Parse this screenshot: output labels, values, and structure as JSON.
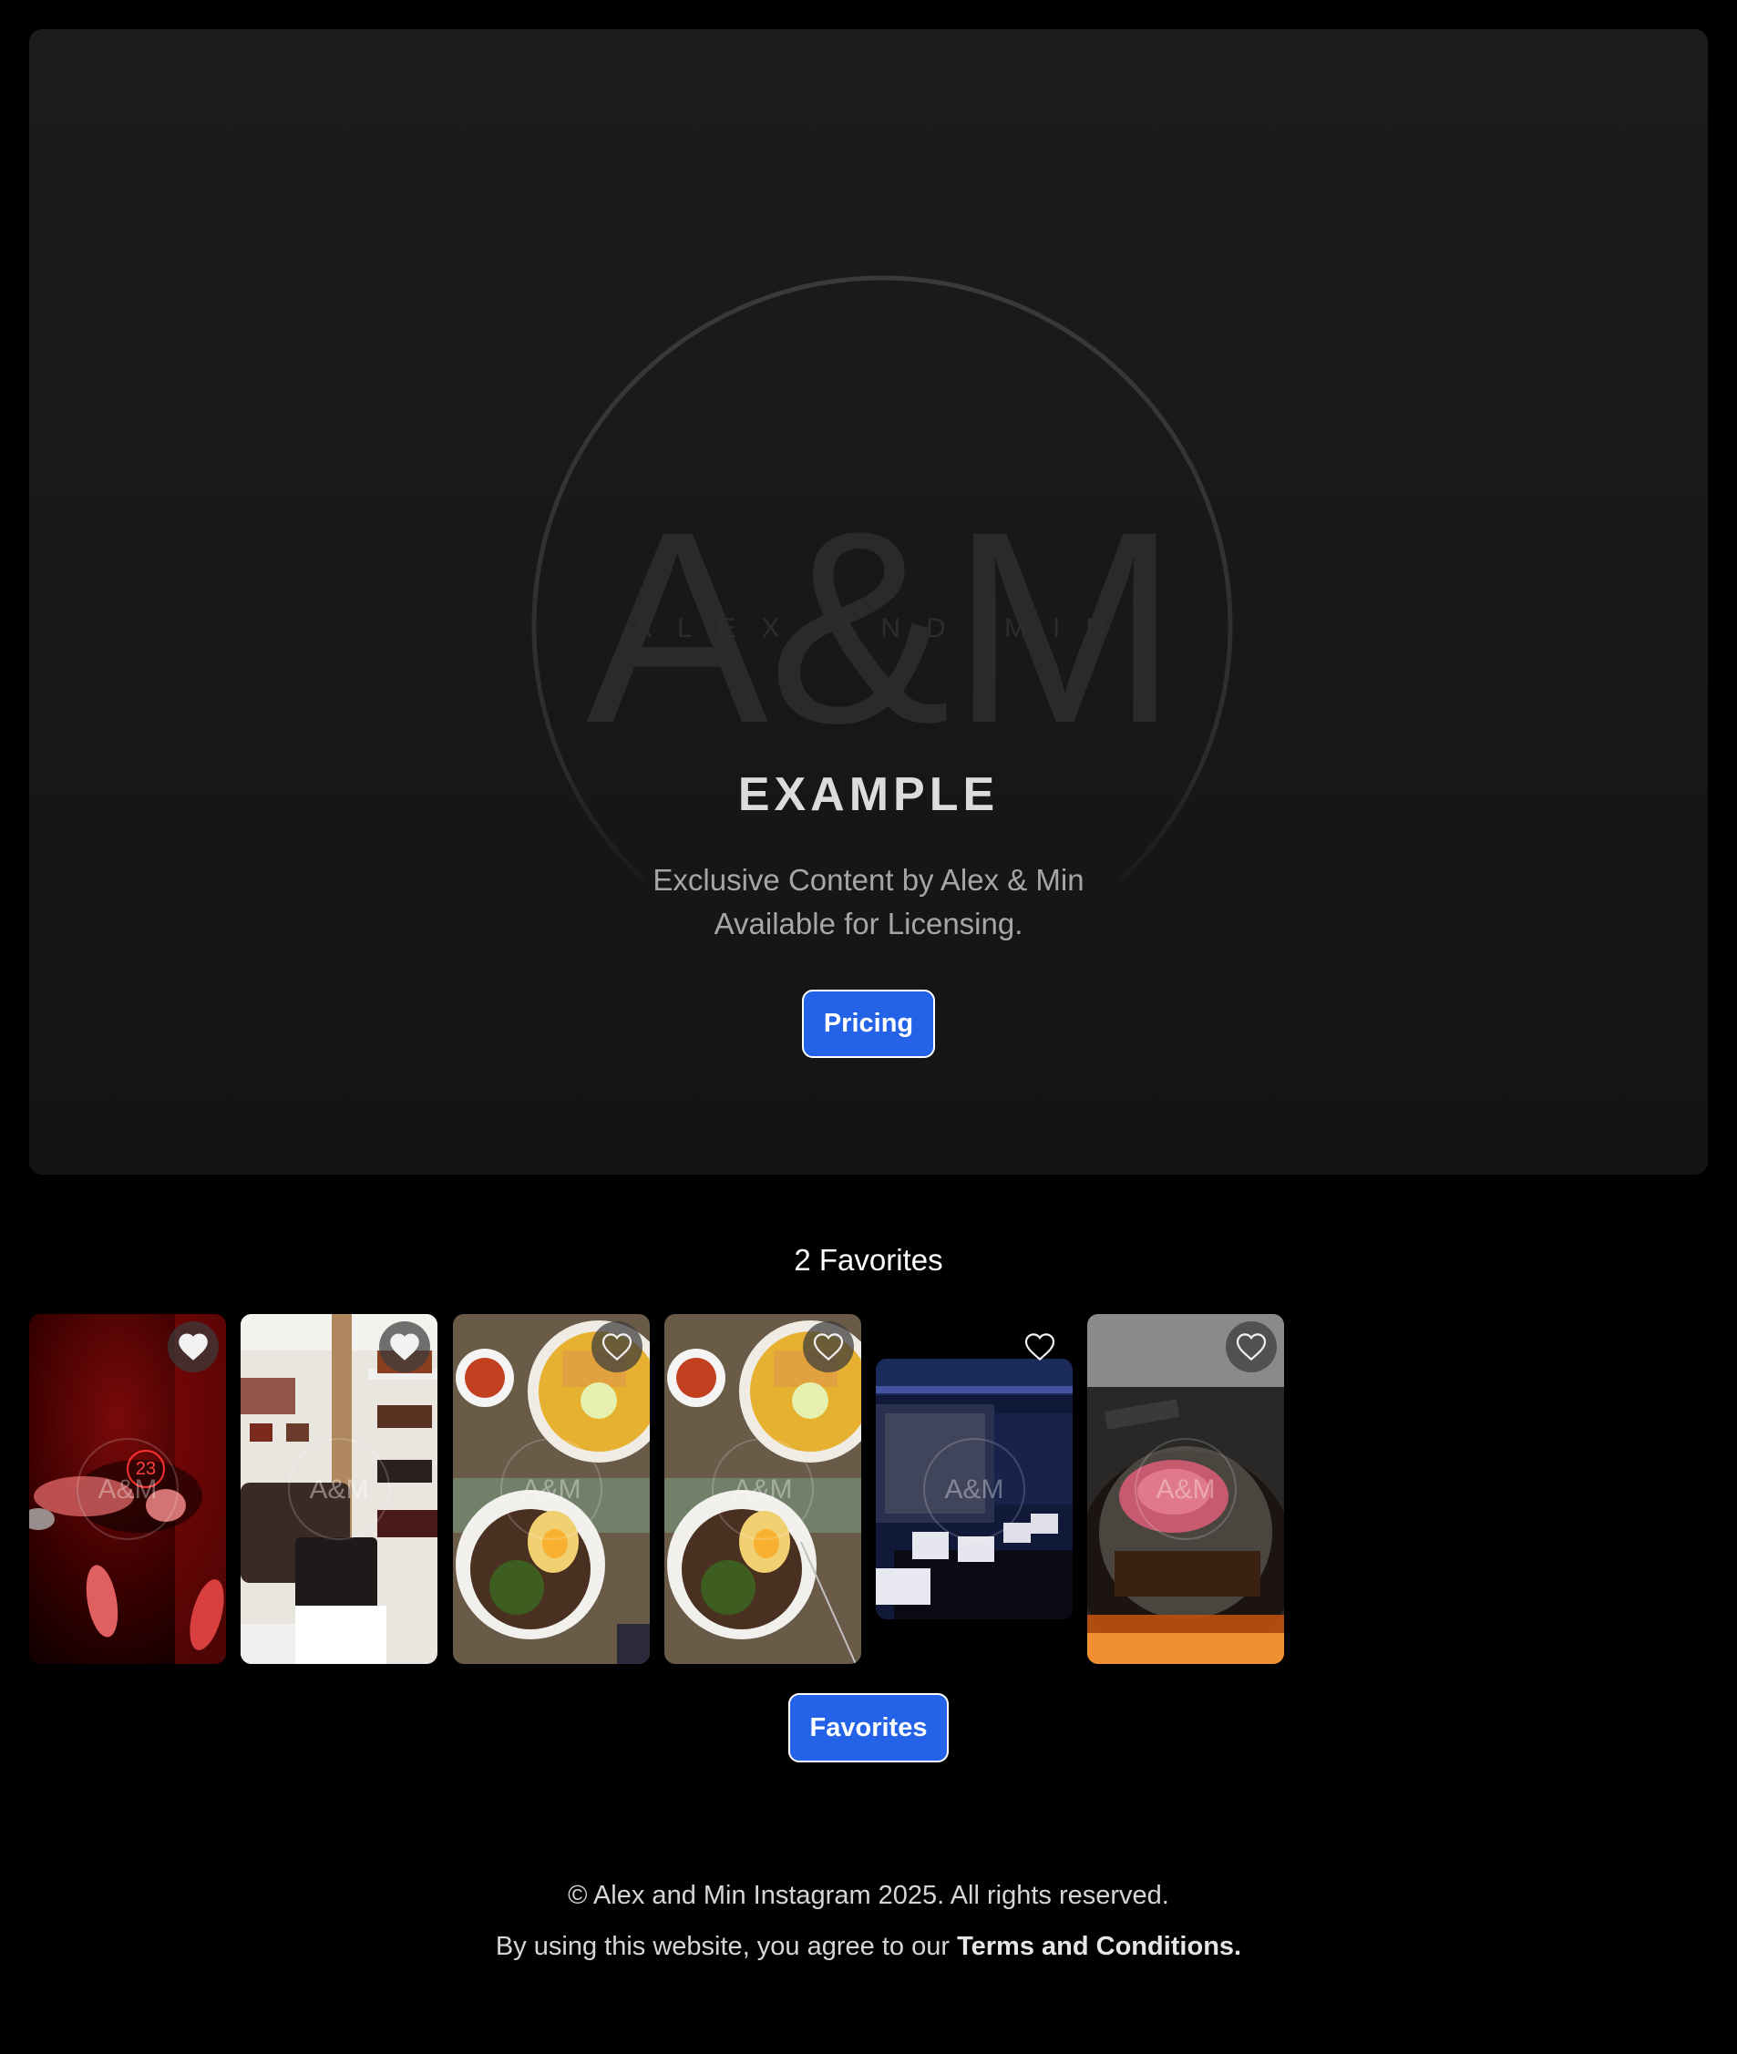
{
  "hero": {
    "logo_text": "A&M",
    "logo_ring_text": "ALEX AND MIN",
    "title": "EXAMPLE",
    "subtitle_line1": "Exclusive Content by Alex & Min",
    "subtitle_line2": "Available for Licensing.",
    "pricing_label": "Pricing"
  },
  "favorites": {
    "heading": "2 Favorites",
    "button_label": "Favorites",
    "watermark": "A&M",
    "items": [
      {
        "subject": "red bowling scene",
        "favorited": true
      },
      {
        "subject": "leather bags store",
        "favorited": true
      },
      {
        "subject": "curry noodles and rice bowl",
        "favorited": false
      },
      {
        "subject": "curry noodles and rice bowl",
        "favorited": false
      },
      {
        "subject": "blue lit event room",
        "favorited": false
      },
      {
        "subject": "steak on grill",
        "favorited": false
      }
    ]
  },
  "footer": {
    "copyright": "© Alex and Min Instagram 2025. All rights reserved.",
    "agree_text": "By using this website, you agree to our ",
    "terms_link": "Terms and Conditions."
  },
  "colors": {
    "page_bg": "#000000",
    "card_bg": "#181818",
    "accent": "#2462e8",
    "text_muted": "#a6a6a6"
  }
}
